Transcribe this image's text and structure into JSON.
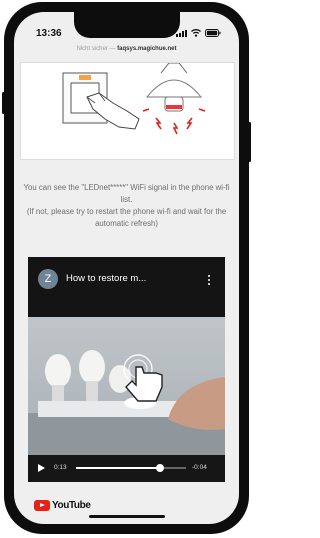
{
  "status_bar": {
    "time": "13:36"
  },
  "browser": {
    "security_text": "Nicht sicher —",
    "domain": "faqsys.magichue.net"
  },
  "instructions": {
    "line1": "You can see the \"LEDnet*****\" WiFi signal in the phone wi-fi list.",
    "line2": "(If not, please try to restart the phone wi-fi and wait for the automatic refresh)"
  },
  "video": {
    "channel_initial": "Z",
    "title": "How to restore m...",
    "current_time": "0:13",
    "remaining_time": "-0:04",
    "progress": 0.76
  },
  "youtube": {
    "wordmark": "YouTube"
  },
  "colors": {
    "youtube_red": "#e62117",
    "screen_bg": "#efefef"
  }
}
